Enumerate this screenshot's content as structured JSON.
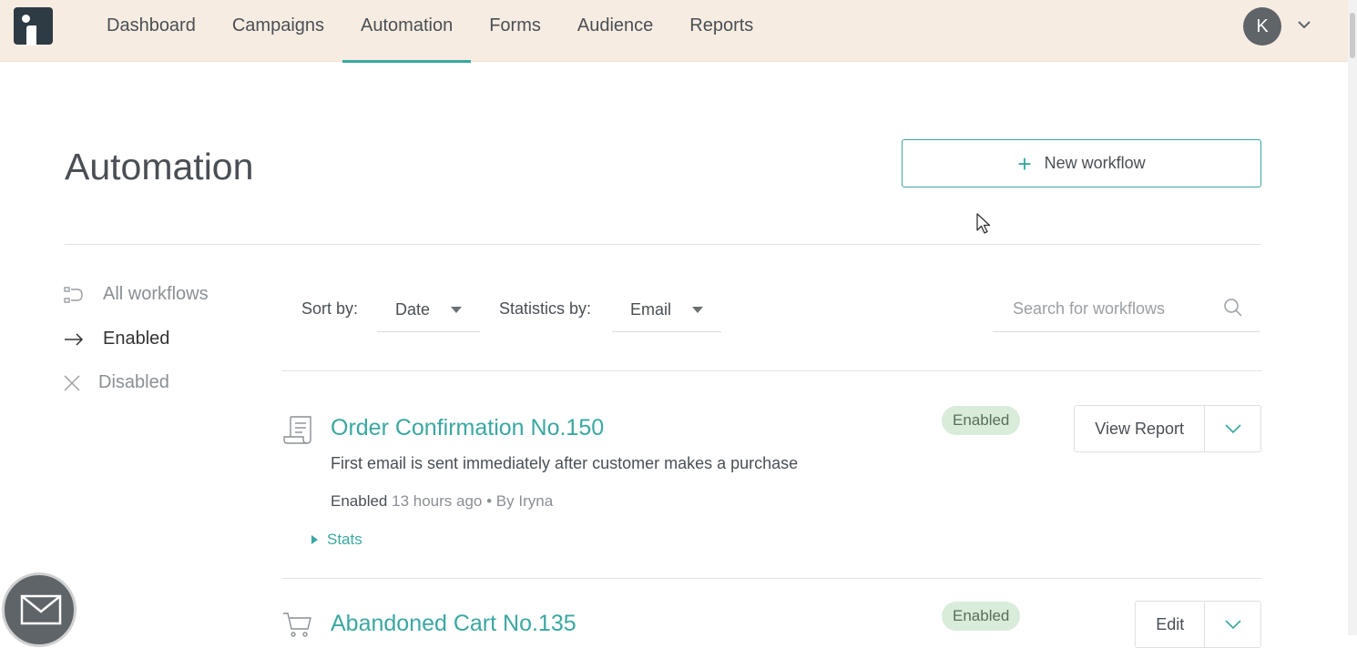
{
  "nav": {
    "items": [
      "Dashboard",
      "Campaigns",
      "Automation",
      "Forms",
      "Audience",
      "Reports"
    ],
    "active": "Automation",
    "avatar_initial": "K"
  },
  "page": {
    "title": "Automation",
    "new_workflow_label": "New workflow"
  },
  "sidebar": {
    "items": [
      {
        "label": "All workflows",
        "icon": "flow-icon"
      },
      {
        "label": "Enabled",
        "icon": "arrow-right-icon"
      },
      {
        "label": "Disabled",
        "icon": "close-icon"
      }
    ],
    "selected": "Enabled"
  },
  "filters": {
    "sort_label": "Sort by:",
    "sort_value": "Date",
    "stats_label": "Statistics by:",
    "stats_value": "Email",
    "search_placeholder": "Search for workflows"
  },
  "workflows": [
    {
      "title": "Order Confirmation No.150",
      "description": "First email is sent immediately after customer makes a purchase",
      "state": "Enabled",
      "time": "13 hours ago",
      "author": "By Iryna",
      "stats_label": "Stats",
      "badge": "Enabled",
      "action": "View Report",
      "icon": "receipt-icon"
    },
    {
      "title": "Abandoned Cart No.135",
      "badge": "Enabled",
      "action": "Edit",
      "icon": "cart-icon"
    }
  ],
  "colors": {
    "accent": "#3aa7a1",
    "topbar": "#f7ece1",
    "badge_bg": "#d8ecd9"
  }
}
